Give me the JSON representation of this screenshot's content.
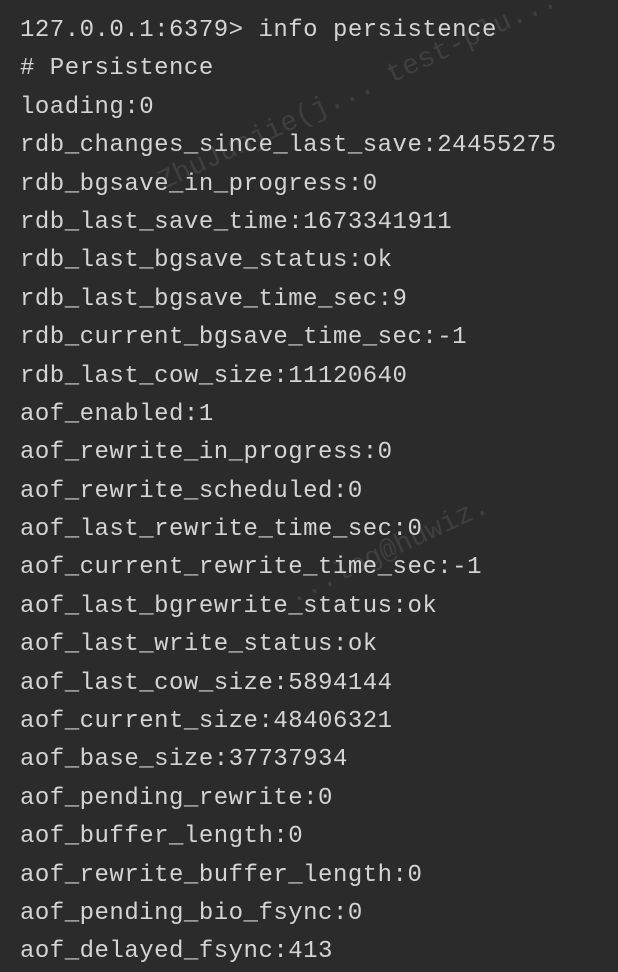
{
  "terminal": {
    "prompt": "127.0.0.1:6379>",
    "command": "info persistence",
    "section_header": "# Persistence",
    "lines": [
      "loading:0",
      "rdb_changes_since_last_save:24455275",
      "rdb_bgsave_in_progress:0",
      "rdb_last_save_time:1673341911",
      "rdb_last_bgsave_status:ok",
      "rdb_last_bgsave_time_sec:9",
      "rdb_current_bgsave_time_sec:-1",
      "rdb_last_cow_size:11120640",
      "aof_enabled:1",
      "aof_rewrite_in_progress:0",
      "aof_rewrite_scheduled:0",
      "aof_last_rewrite_time_sec:0",
      "aof_current_rewrite_time_sec:-1",
      "aof_last_bgrewrite_status:ok",
      "aof_last_write_status:ok",
      "aof_last_cow_size:5894144",
      "aof_current_size:48406321",
      "aof_base_size:37737934",
      "aof_pending_rewrite:0",
      "aof_buffer_length:0",
      "aof_rewrite_buffer_length:0",
      "aof_pending_bio_fsync:0",
      "aof_delayed_fsync:413"
    ],
    "watermarks": [
      "ZhuJunjie(j... test-plu...",
      "...log@huwiz."
    ]
  }
}
